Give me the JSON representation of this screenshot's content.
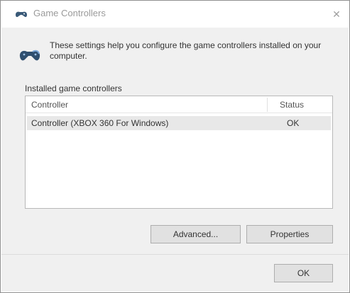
{
  "window": {
    "title": "Game Controllers",
    "close_glyph": "✕",
    "title_icon": "gamepad-icon"
  },
  "info": {
    "icon": "gamepad-icon",
    "text": "These settings help you configure the game controllers installed on your computer."
  },
  "installed": {
    "group_label": "Installed game controllers",
    "columns": [
      "Controller",
      "Status"
    ],
    "rows": [
      {
        "controller": "Controller (XBOX 360 For Windows)",
        "status": "OK"
      }
    ]
  },
  "buttons": {
    "advanced": "Advanced...",
    "properties": "Properties",
    "ok": "OK"
  }
}
